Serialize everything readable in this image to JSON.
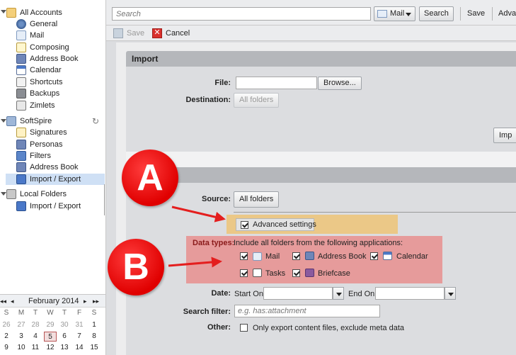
{
  "sidebar": {
    "all_accounts": "All Accounts",
    "all_accounts_items": [
      "General",
      "Mail",
      "Composing",
      "Address Book",
      "Calendar",
      "Shortcuts",
      "Backups",
      "Zimlets"
    ],
    "softspire": "SoftSpire",
    "softspire_items": [
      "Signatures",
      "Personas",
      "Filters",
      "Address Book",
      "Import / Export"
    ],
    "local_folders": "Local Folders",
    "local_items": [
      "Import / Export"
    ]
  },
  "calendar": {
    "title": "February 2014",
    "nav": [
      "◂◂",
      "◂",
      "▸",
      "▸▸"
    ],
    "weekdays": [
      "S",
      "M",
      "T",
      "W",
      "T",
      "F",
      "S"
    ],
    "weeks": [
      [
        "26",
        "27",
        "28",
        "29",
        "30",
        "31",
        "1"
      ],
      [
        "2",
        "3",
        "4",
        "5",
        "6",
        "7",
        "8"
      ],
      [
        "9",
        "10",
        "11",
        "12",
        "13",
        "14",
        "15"
      ]
    ],
    "today": "5"
  },
  "toolbar": {
    "search_placeholder": "Search",
    "scope": "Mail",
    "search_button": "Search",
    "save_button": "Save",
    "advanced_button": "Adva"
  },
  "actions": {
    "save": "Save",
    "cancel": "Cancel"
  },
  "import": {
    "title": "Import",
    "file_label": "File:",
    "browse": "Browse...",
    "destination_label": "Destination:",
    "destination_value": "All folders",
    "import_button": "Imp"
  },
  "export": {
    "source_label": "Source:",
    "source_value": "All folders",
    "advanced_settings": "Advanced settings",
    "data_types_label": "Data types:",
    "data_types_desc": "Include all folders from the following applications:",
    "apps": [
      "Mail",
      "Address Book",
      "Calendar",
      "Tasks",
      "Briefcase"
    ],
    "date_label": "Date:",
    "start_on": "Start On:",
    "end_on": "End On:",
    "search_filter_label": "Search filter:",
    "search_filter_placeholder": "e.g. has:attachment",
    "other_label": "Other:",
    "other_option": "Only export content files, exclude meta data"
  },
  "annotations": [
    "A",
    "B"
  ],
  "colors": {
    "accent": "#e00000",
    "selection": "#cfe0f5",
    "highlight_a": "#f0c06a",
    "highlight_b": "#e98888"
  }
}
